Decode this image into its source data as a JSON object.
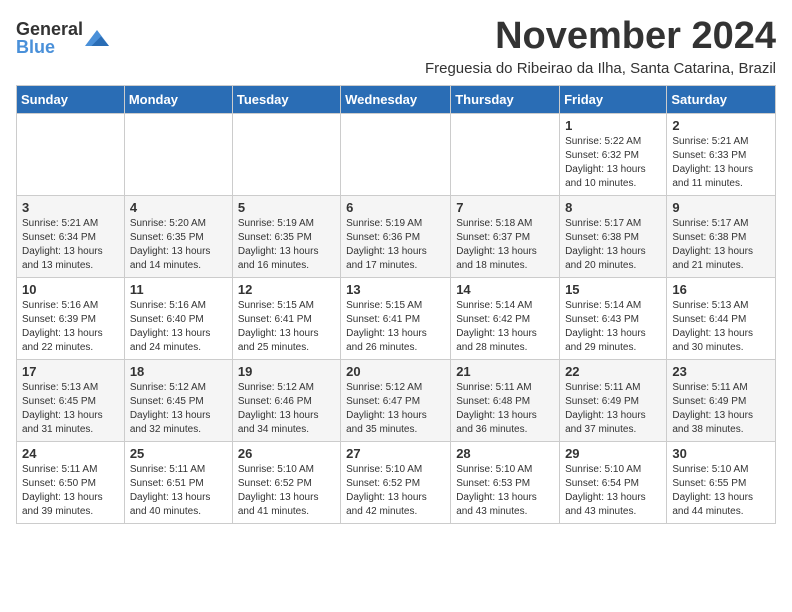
{
  "logo": {
    "general": "General",
    "blue": "Blue"
  },
  "title": "November 2024",
  "subtitle": "Freguesia do Ribeirao da Ilha, Santa Catarina, Brazil",
  "days_header": [
    "Sunday",
    "Monday",
    "Tuesday",
    "Wednesday",
    "Thursday",
    "Friday",
    "Saturday"
  ],
  "weeks": [
    [
      {
        "day": "",
        "info": ""
      },
      {
        "day": "",
        "info": ""
      },
      {
        "day": "",
        "info": ""
      },
      {
        "day": "",
        "info": ""
      },
      {
        "day": "",
        "info": ""
      },
      {
        "day": "1",
        "info": "Sunrise: 5:22 AM\nSunset: 6:32 PM\nDaylight: 13 hours\nand 10 minutes."
      },
      {
        "day": "2",
        "info": "Sunrise: 5:21 AM\nSunset: 6:33 PM\nDaylight: 13 hours\nand 11 minutes."
      }
    ],
    [
      {
        "day": "3",
        "info": "Sunrise: 5:21 AM\nSunset: 6:34 PM\nDaylight: 13 hours\nand 13 minutes."
      },
      {
        "day": "4",
        "info": "Sunrise: 5:20 AM\nSunset: 6:35 PM\nDaylight: 13 hours\nand 14 minutes."
      },
      {
        "day": "5",
        "info": "Sunrise: 5:19 AM\nSunset: 6:35 PM\nDaylight: 13 hours\nand 16 minutes."
      },
      {
        "day": "6",
        "info": "Sunrise: 5:19 AM\nSunset: 6:36 PM\nDaylight: 13 hours\nand 17 minutes."
      },
      {
        "day": "7",
        "info": "Sunrise: 5:18 AM\nSunset: 6:37 PM\nDaylight: 13 hours\nand 18 minutes."
      },
      {
        "day": "8",
        "info": "Sunrise: 5:17 AM\nSunset: 6:38 PM\nDaylight: 13 hours\nand 20 minutes."
      },
      {
        "day": "9",
        "info": "Sunrise: 5:17 AM\nSunset: 6:38 PM\nDaylight: 13 hours\nand 21 minutes."
      }
    ],
    [
      {
        "day": "10",
        "info": "Sunrise: 5:16 AM\nSunset: 6:39 PM\nDaylight: 13 hours\nand 22 minutes."
      },
      {
        "day": "11",
        "info": "Sunrise: 5:16 AM\nSunset: 6:40 PM\nDaylight: 13 hours\nand 24 minutes."
      },
      {
        "day": "12",
        "info": "Sunrise: 5:15 AM\nSunset: 6:41 PM\nDaylight: 13 hours\nand 25 minutes."
      },
      {
        "day": "13",
        "info": "Sunrise: 5:15 AM\nSunset: 6:41 PM\nDaylight: 13 hours\nand 26 minutes."
      },
      {
        "day": "14",
        "info": "Sunrise: 5:14 AM\nSunset: 6:42 PM\nDaylight: 13 hours\nand 28 minutes."
      },
      {
        "day": "15",
        "info": "Sunrise: 5:14 AM\nSunset: 6:43 PM\nDaylight: 13 hours\nand 29 minutes."
      },
      {
        "day": "16",
        "info": "Sunrise: 5:13 AM\nSunset: 6:44 PM\nDaylight: 13 hours\nand 30 minutes."
      }
    ],
    [
      {
        "day": "17",
        "info": "Sunrise: 5:13 AM\nSunset: 6:45 PM\nDaylight: 13 hours\nand 31 minutes."
      },
      {
        "day": "18",
        "info": "Sunrise: 5:12 AM\nSunset: 6:45 PM\nDaylight: 13 hours\nand 32 minutes."
      },
      {
        "day": "19",
        "info": "Sunrise: 5:12 AM\nSunset: 6:46 PM\nDaylight: 13 hours\nand 34 minutes."
      },
      {
        "day": "20",
        "info": "Sunrise: 5:12 AM\nSunset: 6:47 PM\nDaylight: 13 hours\nand 35 minutes."
      },
      {
        "day": "21",
        "info": "Sunrise: 5:11 AM\nSunset: 6:48 PM\nDaylight: 13 hours\nand 36 minutes."
      },
      {
        "day": "22",
        "info": "Sunrise: 5:11 AM\nSunset: 6:49 PM\nDaylight: 13 hours\nand 37 minutes."
      },
      {
        "day": "23",
        "info": "Sunrise: 5:11 AM\nSunset: 6:49 PM\nDaylight: 13 hours\nand 38 minutes."
      }
    ],
    [
      {
        "day": "24",
        "info": "Sunrise: 5:11 AM\nSunset: 6:50 PM\nDaylight: 13 hours\nand 39 minutes."
      },
      {
        "day": "25",
        "info": "Sunrise: 5:11 AM\nSunset: 6:51 PM\nDaylight: 13 hours\nand 40 minutes."
      },
      {
        "day": "26",
        "info": "Sunrise: 5:10 AM\nSunset: 6:52 PM\nDaylight: 13 hours\nand 41 minutes."
      },
      {
        "day": "27",
        "info": "Sunrise: 5:10 AM\nSunset: 6:52 PM\nDaylight: 13 hours\nand 42 minutes."
      },
      {
        "day": "28",
        "info": "Sunrise: 5:10 AM\nSunset: 6:53 PM\nDaylight: 13 hours\nand 43 minutes."
      },
      {
        "day": "29",
        "info": "Sunrise: 5:10 AM\nSunset: 6:54 PM\nDaylight: 13 hours\nand 43 minutes."
      },
      {
        "day": "30",
        "info": "Sunrise: 5:10 AM\nSunset: 6:55 PM\nDaylight: 13 hours\nand 44 minutes."
      }
    ]
  ]
}
